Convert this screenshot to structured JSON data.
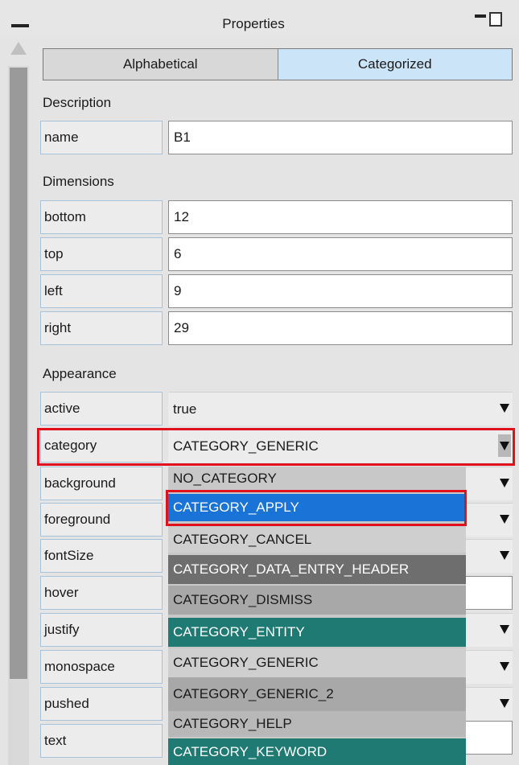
{
  "panel": {
    "title": "Properties"
  },
  "tabs": [
    {
      "label": "Alphabetical"
    },
    {
      "label": "Categorized"
    }
  ],
  "sections": {
    "description": "Description",
    "dimensions": "Dimensions",
    "appearance": "Appearance"
  },
  "props": {
    "name": {
      "label": "name",
      "value": "B1"
    },
    "bottom": {
      "label": "bottom",
      "value": "12"
    },
    "top": {
      "label": "top",
      "value": "6"
    },
    "left": {
      "label": "left",
      "value": "9"
    },
    "right": {
      "label": "right",
      "value": "29"
    },
    "active": {
      "label": "active",
      "value": "true"
    },
    "category": {
      "label": "category",
      "value": "CATEGORY_GENERIC"
    },
    "background": {
      "label": "background"
    },
    "foreground": {
      "label": "foreground"
    },
    "fontSize": {
      "label": "fontSize"
    },
    "hover": {
      "label": "hover"
    },
    "justify": {
      "label": "justify"
    },
    "monospace": {
      "label": "monospace"
    },
    "pushed": {
      "label": "pushed"
    },
    "text": {
      "label": "text"
    }
  },
  "dropdown": {
    "options": [
      {
        "label": "NO_CATEGORY",
        "bg": "#c8c8c8",
        "fg": "#1a1a1a"
      },
      {
        "label": "CATEGORY_APPLY",
        "bg": "#1a73d6",
        "fg": "#ffffff"
      },
      {
        "label": "CATEGORY_CANCEL",
        "bg": "#cfcfcf",
        "fg": "#1a1a1a"
      },
      {
        "label": "CATEGORY_DATA_ENTRY_HEADER",
        "bg": "#6e6e6e",
        "fg": "#ffffff"
      },
      {
        "label": "CATEGORY_DISMISS",
        "bg": "#a8a8a8",
        "fg": "#1a1a1a"
      },
      {
        "label": "CATEGORY_ENTITY",
        "bg": "#1f7a73",
        "fg": "#ffffff"
      },
      {
        "label": "CATEGORY_GENERIC",
        "bg": "#cfcfcf",
        "fg": "#1a1a1a"
      },
      {
        "label": "CATEGORY_GENERIC_2",
        "bg": "#a8a8a8",
        "fg": "#1a1a1a"
      },
      {
        "label": "CATEGORY_HELP",
        "bg": "#b8b8b8",
        "fg": "#1a1a1a"
      },
      {
        "label": "CATEGORY_KEYWORD",
        "bg": "#1f7a73",
        "fg": "#ffffff"
      }
    ]
  },
  "colors": {
    "highlight_border": "#e0101c",
    "selected_tab": "#cce4f7"
  }
}
